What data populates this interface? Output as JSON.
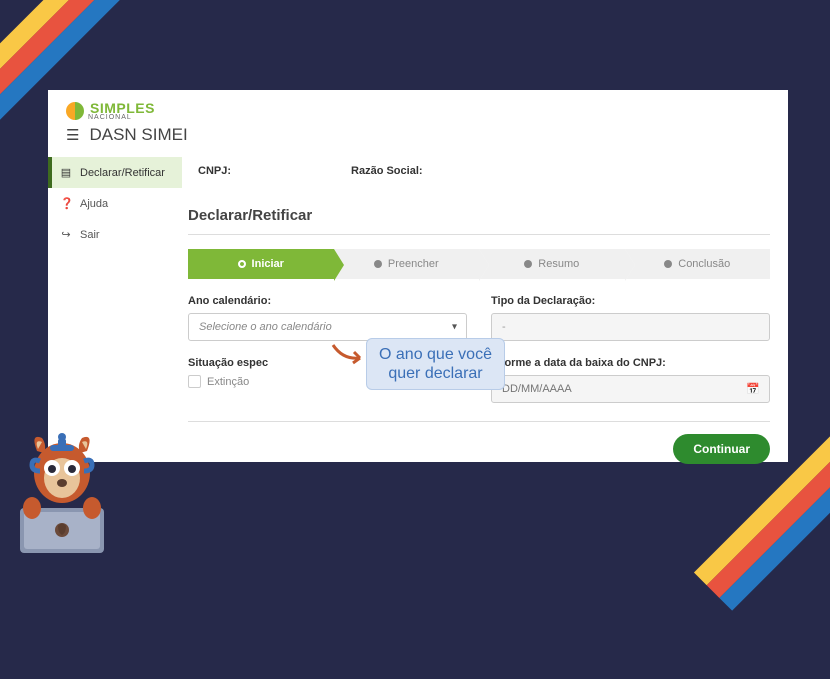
{
  "logo": {
    "brand": "SIMPLES",
    "sub": "NACIONAL"
  },
  "app_title": "DASN SIMEI",
  "sidebar": {
    "items": [
      {
        "label": "Declarar/Retificar",
        "icon": "document"
      },
      {
        "label": "Ajuda",
        "icon": "help"
      },
      {
        "label": "Sair",
        "icon": "logout"
      }
    ]
  },
  "info": {
    "cnpj_label": "CNPJ:",
    "razao_label": "Razão Social:"
  },
  "section_title": "Declarar/Retificar",
  "steps": [
    {
      "label": "Iniciar",
      "active": true
    },
    {
      "label": "Preencher",
      "active": false
    },
    {
      "label": "Resumo",
      "active": false
    },
    {
      "label": "Conclusão",
      "active": false
    }
  ],
  "form": {
    "ano_label": "Ano calendário:",
    "ano_placeholder": "Selecione o ano calendário",
    "tipo_label": "Tipo da Declaração:",
    "tipo_value": "-",
    "situacao_label": "Situação espec",
    "extincao_label": "Extinção",
    "data_label": "Informe a data da baixa do CNPJ:",
    "data_placeholder": "DD/MM/AAAA"
  },
  "button": {
    "continue": "Continuar"
  },
  "annotation": {
    "line1": "O ano que você",
    "line2": "quer declarar"
  }
}
